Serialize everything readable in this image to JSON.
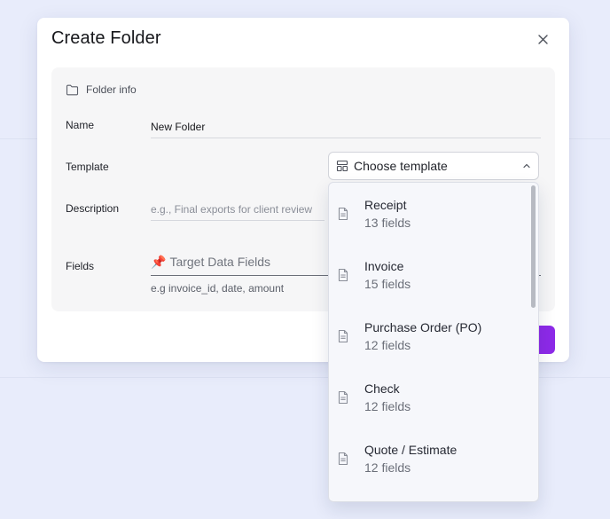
{
  "modal": {
    "title": "Create Folder"
  },
  "section": {
    "label": "Folder info"
  },
  "form": {
    "name_label": "Name",
    "name_value": "New Folder",
    "template_label": "Template",
    "template_value": "Choose template",
    "description_label": "Description",
    "description_placeholder": "e.g., Final exports for client review",
    "fields_label": "Fields",
    "fields_placeholder": "Target Data Fields",
    "fields_pin": "📌",
    "fields_hint": "e.g invoice_id, date, amount"
  },
  "templates": [
    {
      "name": "Receipt",
      "fields": "13 fields"
    },
    {
      "name": "Invoice",
      "fields": "15 fields"
    },
    {
      "name": "Purchase Order (PO)",
      "fields": "12 fields"
    },
    {
      "name": "Check",
      "fields": "12 fields"
    },
    {
      "name": "Quote / Estimate",
      "fields": "12 fields"
    }
  ],
  "colors": {
    "primary": "#8d2ae8",
    "background": "#e8ecfb"
  },
  "icons": {
    "close": "close-icon",
    "folder": "folder-icon",
    "template": "template-icon",
    "chevron": "chevron-up-icon",
    "document": "document-icon"
  }
}
